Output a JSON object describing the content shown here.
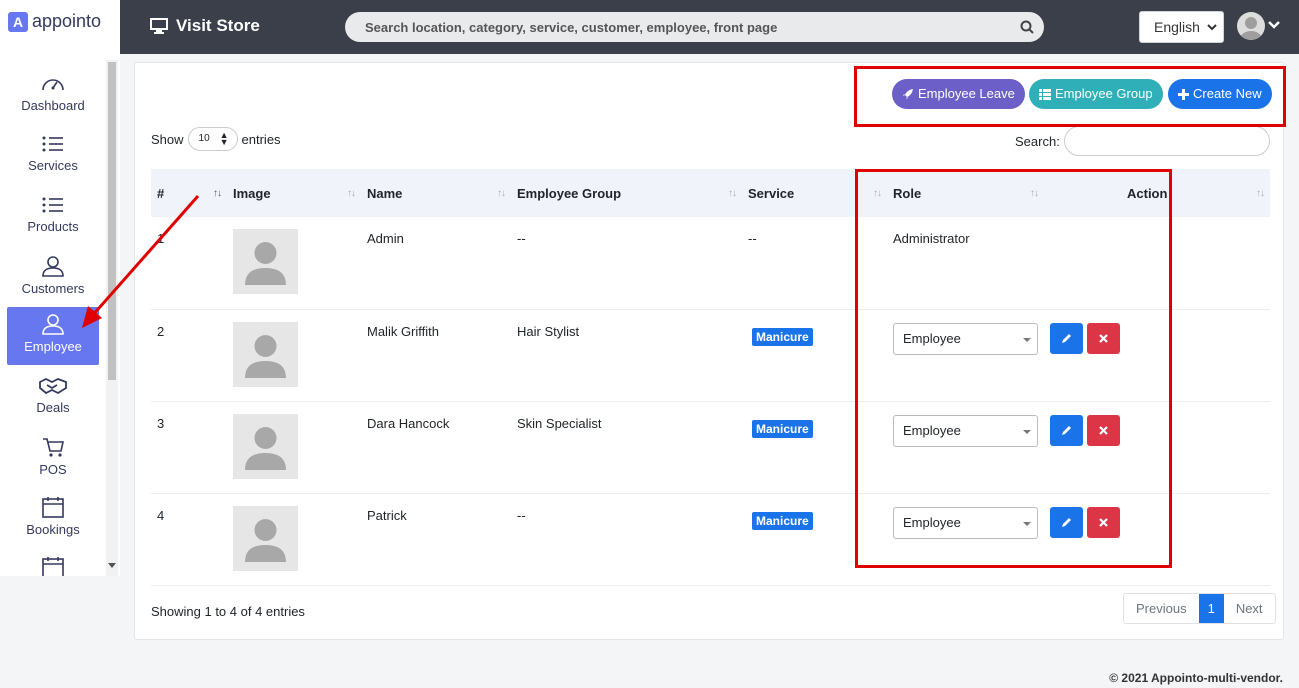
{
  "brand": {
    "logo_letter": "A",
    "name": "appointo"
  },
  "topbar": {
    "visit_store": "Visit Store",
    "search_placeholder": "Search location, category, service, customer, employee, front page",
    "language": "English"
  },
  "sidebar": {
    "items": [
      {
        "label": "Dashboard",
        "icon": "speedometer-icon"
      },
      {
        "label": "Services",
        "icon": "list-icon"
      },
      {
        "label": "Products",
        "icon": "list-icon"
      },
      {
        "label": "Customers",
        "icon": "user-icon"
      },
      {
        "label": "Employee",
        "icon": "user-icon",
        "active": true
      },
      {
        "label": "Deals",
        "icon": "handshake-icon"
      },
      {
        "label": "POS",
        "icon": "cart-icon"
      },
      {
        "label": "Bookings",
        "icon": "calendar-icon"
      }
    ]
  },
  "actions": {
    "employee_leave": "Employee Leave",
    "employee_group": "Employee Group",
    "create_new": "Create New"
  },
  "table_controls": {
    "show": "Show",
    "length": "10",
    "entries": "entries",
    "search_label": "Search:"
  },
  "table": {
    "headers": [
      "#",
      "Image",
      "Name",
      "Employee Group",
      "Service",
      "Role",
      "Action"
    ],
    "rows": [
      {
        "num": "1",
        "name": "Admin",
        "group": "--",
        "service": "--",
        "role": "Administrator"
      },
      {
        "num": "2",
        "name": "Malik Griffith",
        "group": "Hair Stylist",
        "service": "Manicure",
        "role": "Employee"
      },
      {
        "num": "3",
        "name": "Dara Hancock",
        "group": "Skin Specialist",
        "service": "Manicure",
        "role": "Employee"
      },
      {
        "num": "4",
        "name": "Patrick",
        "group": "--",
        "service": "Manicure",
        "role": "Employee"
      }
    ]
  },
  "pagination": {
    "info": "Showing 1 to 4 of 4 entries",
    "previous": "Previous",
    "current": "1",
    "next": "Next"
  },
  "footer": {
    "copyright": "© 2021 Appointo-multi-vendor."
  },
  "colors": {
    "accent": "#6777ef",
    "primary": "#1a73e8",
    "danger": "#dc3545",
    "annotation": "#e00000"
  }
}
